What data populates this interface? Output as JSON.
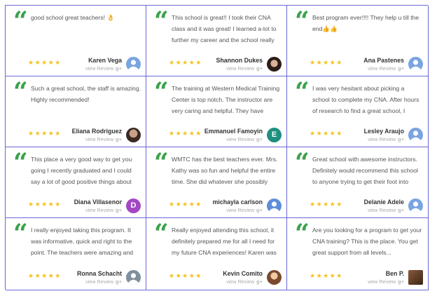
{
  "star_color": "#f3c21b",
  "quote_color": "#3aa24a",
  "border_color": "#6a67d8",
  "view_review_label": "view Review",
  "gplus_label": "g+",
  "rating_stars": "★★★★★",
  "reviews": [
    {
      "text": "good school great teachers! 👌",
      "name": "Karen Vega",
      "rating": 5,
      "avatar": "default-avatar"
    },
    {
      "text": "This school is great!! I took their CNA class and it was great! I learned a-lot to further my career and the school really helps the...",
      "name": "Shannon Dukes",
      "rating": 5,
      "avatar": "photo"
    },
    {
      "text": "Best program ever!!!! They help u till the end👍👍",
      "name": "Ana Pastenes",
      "rating": 5,
      "avatar": "default-avatar"
    },
    {
      "text": "Such a great school, the staff is amazing. Highly recommended!",
      "name": "Eliana Rodriguez",
      "rating": 5,
      "avatar": "photo"
    },
    {
      "text": "The training at Western Medical Training Center is top notch. The instructor are very caring and helpful. They have course that...",
      "name": "Emmanuel Famoyin",
      "rating": 5,
      "avatar": "letter",
      "avatar_letter": "E"
    },
    {
      "text": "I was very hesitant about picking a school to complete my CNA. After hours of research to find a great school, I chose...",
      "name": "Lesley Araujo",
      "rating": 5,
      "avatar": "default-avatar"
    },
    {
      "text": "This place a very good way to get you going I recently graduated and I could say a lot of good positive things about this...",
      "name": "Diana Villasenor",
      "rating": 5,
      "avatar": "letter",
      "avatar_letter": "D"
    },
    {
      "text": "WMTC has the best teachers ever. Mrs. Kathy was so fun and helpful the entire time. She did whatever she possibly could...",
      "name": "michayla carlson",
      "rating": 5,
      "avatar": "default-avatar"
    },
    {
      "text": "Great school with awesome instructors. Definitely would recommend this school to anyone trying to get their foot into the...",
      "name": "Delanie Adele",
      "rating": 5,
      "avatar": "default-avatar"
    },
    {
      "text": "I really enjoyed taking this program. It was informative, quick and right to the point. The teachers were amazing and super...",
      "name": "Ronna Schacht",
      "rating": 5,
      "avatar": "default-avatar"
    },
    {
      "text": "Really enjoyed attending this school, it definitely prepared me for all I need for my future CNA experiences! Karen was a...",
      "name": "Kevin Comito",
      "rating": 5,
      "avatar": "photo"
    },
    {
      "text": "Are you looking for a program to get your CNA training? This is the place. You get great support from all levels...",
      "name": "Ben P.",
      "rating": 5,
      "avatar": "photo"
    }
  ]
}
